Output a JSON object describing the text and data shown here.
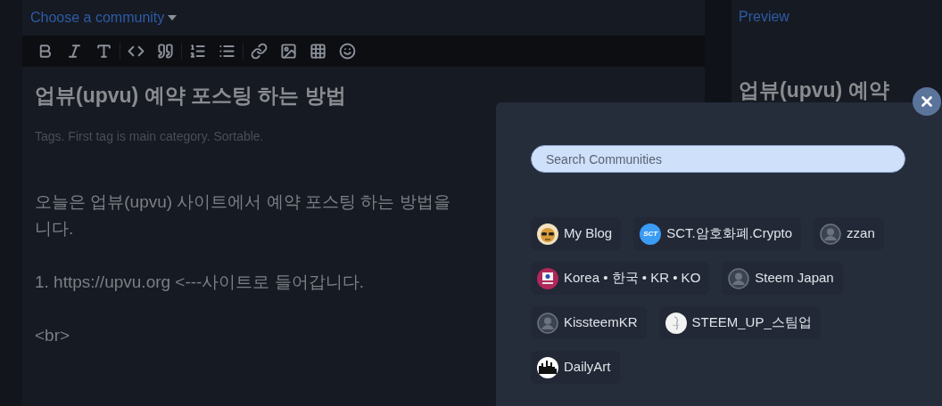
{
  "editor": {
    "community_selector": "Choose a community",
    "title": "업뷰(upvu) 예약 포스팅 하는 방법",
    "tags_placeholder": "Tags. First tag is main category. Sortable.",
    "body_paragraphs": [
      [
        "오늘은 업뷰(upvu) 사이트에서 예약 포스팅 하는 방법을",
        "니다."
      ],
      [
        "1. https://upvu.org <---사이트로 들어갑니다."
      ],
      [
        "<br>"
      ]
    ]
  },
  "preview": {
    "label": "Preview",
    "title": "업뷰(upvu) 예약"
  },
  "community_modal": {
    "search": {
      "placeholder": "Search Communities"
    },
    "communities": [
      {
        "name": "My Blog",
        "kind": "mascot"
      },
      {
        "name": "SCT.암호화폐.Crypto",
        "kind": "logo",
        "avatar_label": "SCT"
      },
      {
        "name": "zzan",
        "kind": "default"
      },
      {
        "name": "Korea • 한국 • KR • KO",
        "kind": "flag"
      },
      {
        "name": "Steem Japan",
        "kind": "default"
      },
      {
        "name": "KissteemKR",
        "kind": "default"
      },
      {
        "name": "STEEM_UP_스팀업",
        "kind": "sketch"
      },
      {
        "name": "DailyArt",
        "kind": "skyline"
      }
    ]
  }
}
